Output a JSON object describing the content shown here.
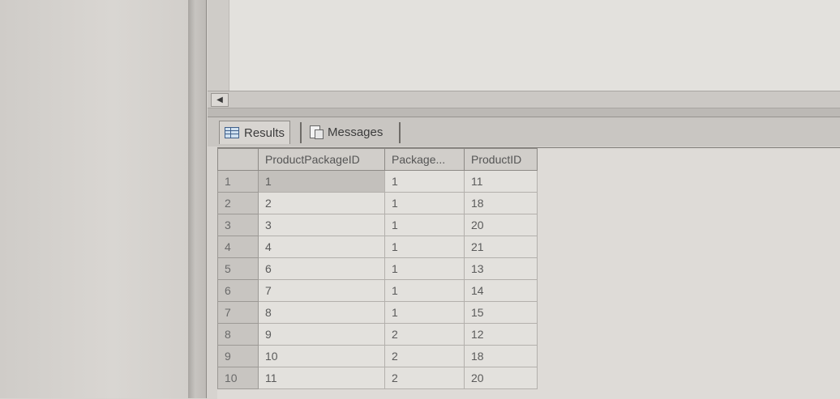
{
  "result_tabs": {
    "results_label": "Results",
    "messages_label": "Messages"
  },
  "grid": {
    "columns": [
      "ProductPackageID",
      "Package...",
      "ProductID"
    ],
    "rows": [
      {
        "n": "1",
        "c1": "1",
        "c2": "1",
        "c3": "11"
      },
      {
        "n": "2",
        "c1": "2",
        "c2": "1",
        "c3": "18"
      },
      {
        "n": "3",
        "c1": "3",
        "c2": "1",
        "c3": "20"
      },
      {
        "n": "4",
        "c1": "4",
        "c2": "1",
        "c3": "21"
      },
      {
        "n": "5",
        "c1": "6",
        "c2": "1",
        "c3": "13"
      },
      {
        "n": "6",
        "c1": "7",
        "c2": "1",
        "c3": "14"
      },
      {
        "n": "7",
        "c1": "8",
        "c2": "1",
        "c3": "15"
      },
      {
        "n": "8",
        "c1": "9",
        "c2": "2",
        "c3": "12"
      },
      {
        "n": "9",
        "c1": "10",
        "c2": "2",
        "c3": "18"
      },
      {
        "n": "10",
        "c1": "11",
        "c2": "2",
        "c3": "20"
      }
    ]
  }
}
